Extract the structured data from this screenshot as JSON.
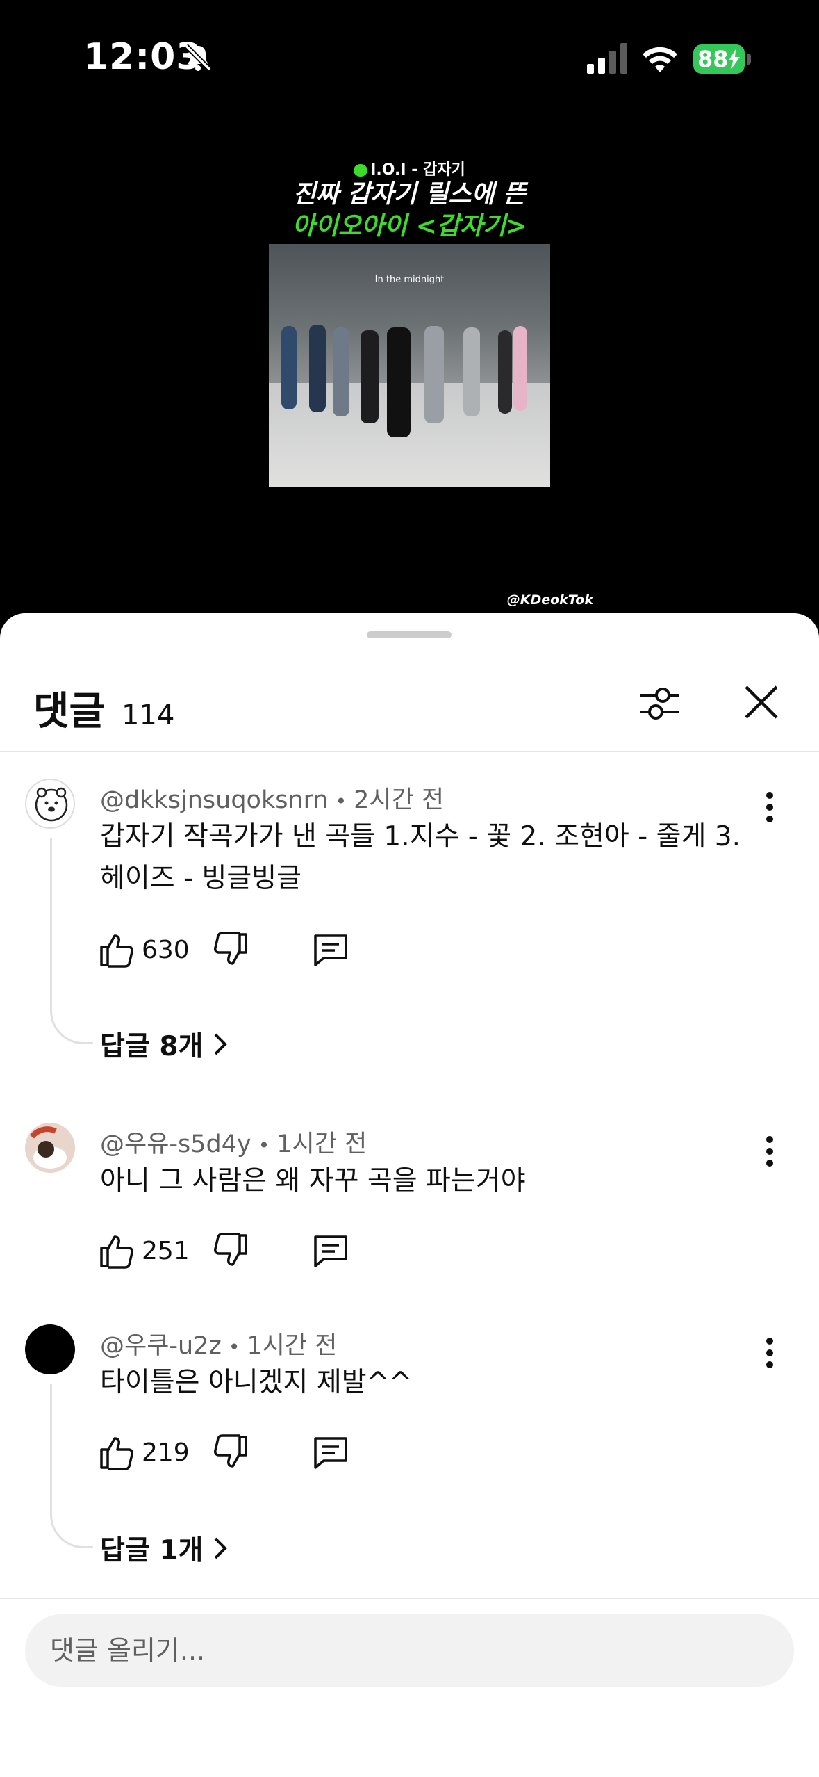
{
  "status_bar": {
    "time": "12:03",
    "battery": "88"
  },
  "video": {
    "tag": "I.O.I - 갑자기",
    "title_line1": "진짜 갑자기 릴스에 뜬",
    "title_line2": "아이오아이 <갑자기>",
    "caption": "In the midnight",
    "watermark": "@KDeokTok",
    "accent_color": "#3ddc2b"
  },
  "comments_panel": {
    "title": "댓글",
    "count": "114",
    "icons": [
      "filter-icon",
      "close-icon"
    ]
  },
  "comments": [
    {
      "author": "@dkksjnsuqoksnrn",
      "time": "2시간 전",
      "text": "갑자기 작곡가가 낸 곡들 1.지수 - 꽃 2. 조현아 - 줄게 3. 헤이즈 - 빙글빙글",
      "likes": "630",
      "replies": "답글 8개"
    },
    {
      "author": "@우유-s5d4y",
      "time": "1시간 전",
      "text": "아니 그 사람은 왜 자꾸 곡을 파는거야",
      "likes": "251"
    },
    {
      "author": "@우쿠-u2z",
      "time": "1시간 전",
      "text": "타이틀은 아니겠지 제발^^",
      "likes": "219",
      "replies": "답글 1개"
    }
  ],
  "composer": {
    "placeholder": "댓글 올리기..."
  }
}
